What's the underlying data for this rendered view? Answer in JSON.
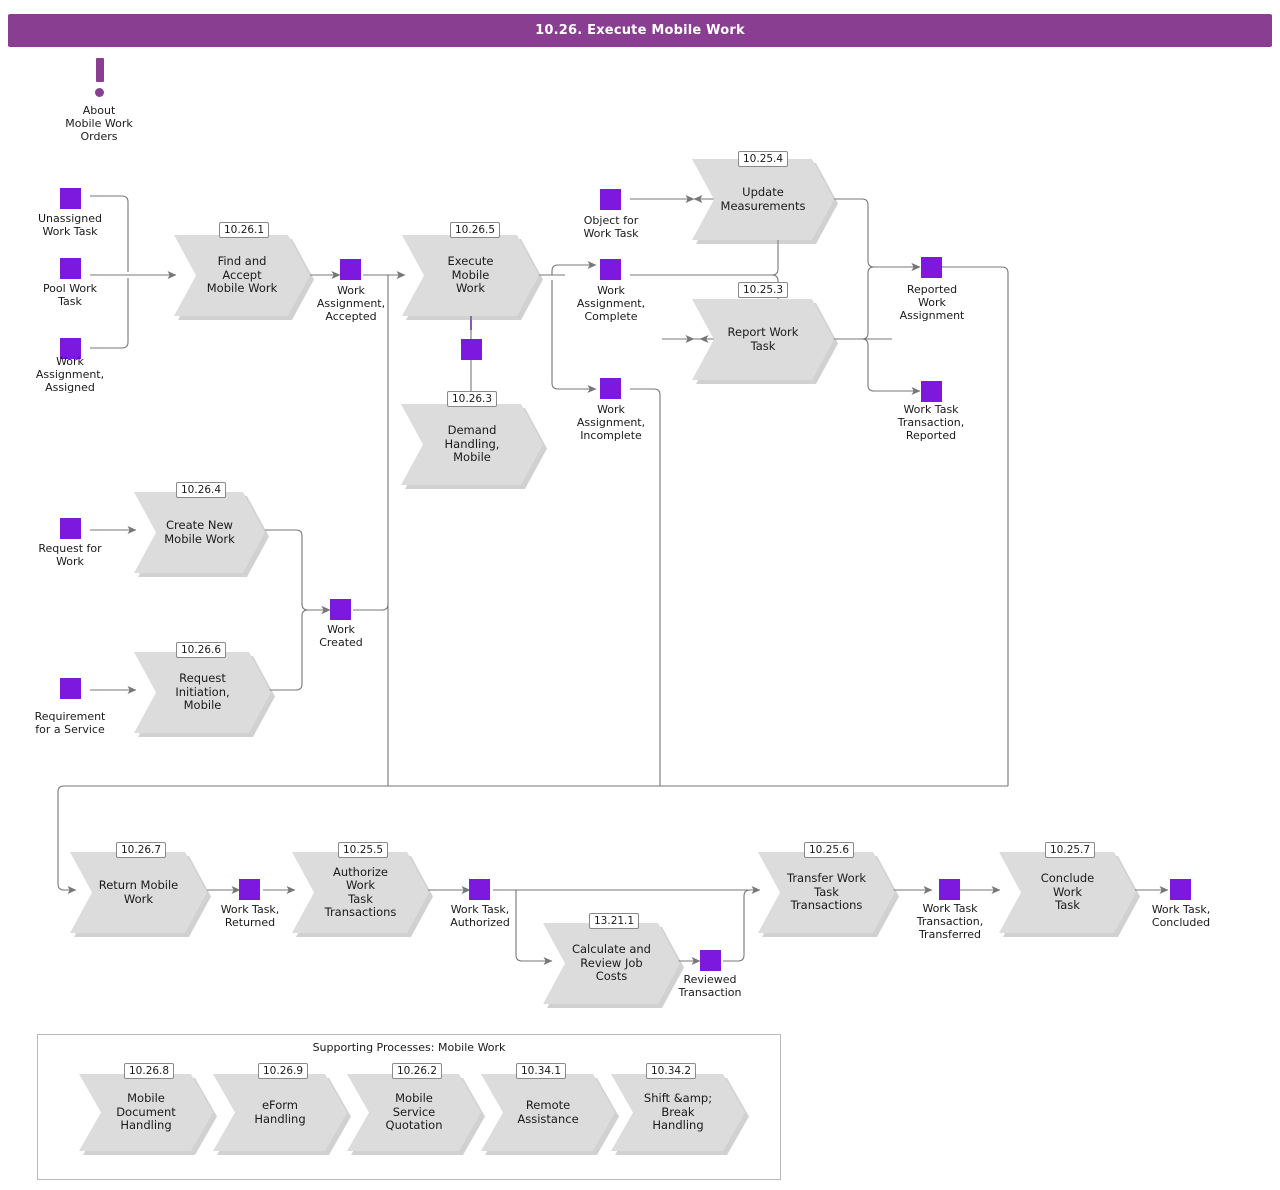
{
  "header": {
    "title": "10.26. Execute Mobile Work",
    "bar_color": "#8A3E92"
  },
  "colors": {
    "entity_purple": "#7D19DE",
    "process_gray": "#DCDCDC",
    "connector_gray": "#777777",
    "panel_border": "#B9B9B9"
  },
  "note": {
    "name": "about-note",
    "icon": "exclamation-icon",
    "text": "About\nMobile Work\nOrders"
  },
  "entities": [
    {
      "id": "unassigned-work-task",
      "label": "Unassigned\nWork Task"
    },
    {
      "id": "pool-work-task",
      "label": "Pool Work\nTask"
    },
    {
      "id": "work-assignment-assigned",
      "label": "Work\nAssignment,\nAssigned"
    },
    {
      "id": "work-assignment-accepted",
      "label": "Work\nAssignment,\nAccepted"
    },
    {
      "id": "object-for-work-task",
      "label": "Object for\nWork Task"
    },
    {
      "id": "work-assignment-complete",
      "label": "Work\nAssignment,\nComplete"
    },
    {
      "id": "work-assignment-incomplete",
      "label": "Work\nAssignment,\nIncomplete"
    },
    {
      "id": "reported-work-assignment",
      "label": "Reported\nWork\nAssignment"
    },
    {
      "id": "work-task-transaction-reported",
      "label": "Work Task\nTransaction,\nReported"
    },
    {
      "id": "demand-entity",
      "label": ""
    },
    {
      "id": "request-for-work",
      "label": "Request for\nWork"
    },
    {
      "id": "requirement-for-a-service",
      "label": "Requirement\nfor a Service"
    },
    {
      "id": "work-created",
      "label": "Work\nCreated"
    },
    {
      "id": "work-task-returned",
      "label": "Work Task,\nReturned"
    },
    {
      "id": "work-task-authorized",
      "label": "Work Task,\nAuthorized"
    },
    {
      "id": "reviewed-transaction",
      "label": "Reviewed\nTransaction"
    },
    {
      "id": "work-task-transaction-transferred",
      "label": "Work Task\nTransaction,\nTransferred"
    },
    {
      "id": "work-task-concluded",
      "label": "Work Task,\nConcluded"
    }
  ],
  "processes": [
    {
      "id": "find-and-accept-mobile-work",
      "code": "10.26.1",
      "label": "Find and Accept\nMobile Work"
    },
    {
      "id": "execute-mobile-work",
      "code": "10.26.5",
      "label": "Execute Mobile\nWork"
    },
    {
      "id": "demand-handling-mobile",
      "code": "10.26.3",
      "label": "Demand\nHandling, Mobile"
    },
    {
      "id": "update-measurements",
      "code": "10.25.4",
      "label": "Update\nMeasurements"
    },
    {
      "id": "report-work-task",
      "code": "10.25.3",
      "label": "Report Work\nTask"
    },
    {
      "id": "create-new-mobile-work",
      "code": "10.26.4",
      "label": "Create New\nMobile Work"
    },
    {
      "id": "request-initiation-mobile",
      "code": "10.26.6",
      "label": "Request\nInitiation, Mobile"
    },
    {
      "id": "return-mobile-work",
      "code": "10.26.7",
      "label": "Return Mobile\nWork"
    },
    {
      "id": "authorize-work-task-transactions",
      "code": "10.25.5",
      "label": "Authorize Work\nTask\nTransactions"
    },
    {
      "id": "calculate-and-review-job-costs",
      "code": "13.21.1",
      "label": "Calculate and\nReview Job\nCosts"
    },
    {
      "id": "transfer-work-task-transactions",
      "code": "10.25.6",
      "label": "Transfer Work\nTask\nTransactions"
    },
    {
      "id": "conclude-work-task",
      "code": "10.25.7",
      "label": "Conclude Work\nTask"
    }
  ],
  "support": {
    "title": "Supporting Processes: Mobile Work",
    "items": [
      {
        "id": "mobile-document-handling",
        "code": "10.26.8",
        "label": "Mobile\nDocument\nHandling"
      },
      {
        "id": "eform-handling",
        "code": "10.26.9",
        "label": "eForm Handling"
      },
      {
        "id": "mobile-service-quotation",
        "code": "10.26.2",
        "label": "Mobile Service\nQuotation"
      },
      {
        "id": "remote-assistance",
        "code": "10.34.1",
        "label": "Remote\nAssistance"
      },
      {
        "id": "shift-break-handling",
        "code": "10.34.2",
        "label": "Shift &amp; Break\nHandling"
      }
    ]
  }
}
